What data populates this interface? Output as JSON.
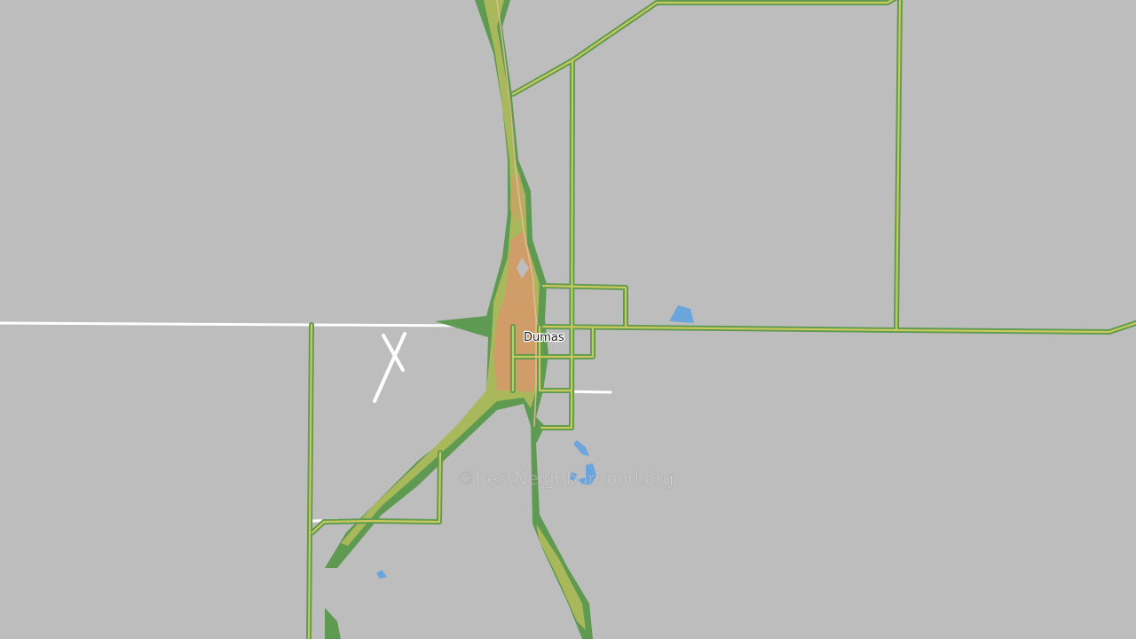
{
  "map": {
    "city_label": "Dumas",
    "watermark": "©BestNeighborhood.org",
    "colors": {
      "background": "#bdbdbd",
      "road_outer": "#5f9a52",
      "road_inner": "#c8c95a",
      "density_low": "#5f9a52",
      "density_mid": "#a9b85a",
      "density_high": "#d49a6a",
      "water": "#6aa6dd",
      "rail": "#ffffff"
    }
  }
}
